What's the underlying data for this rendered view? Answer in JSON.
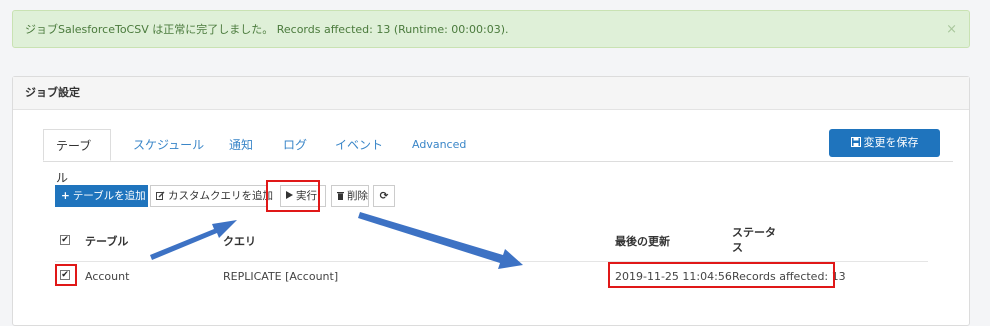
{
  "alert": {
    "message": "ジョブSalesforceToCSV は正常に完了しました。 Records affected: 13 (Runtime: 00:00:03).",
    "close": "×"
  },
  "panel": {
    "title": "ジョブ設定"
  },
  "tabs": [
    {
      "label": "テーブル"
    },
    {
      "label": "スケジュール"
    },
    {
      "label": "通知"
    },
    {
      "label": "ログ"
    },
    {
      "label": "イベント"
    },
    {
      "label": "Advanced"
    }
  ],
  "save_button": {
    "label": "変更を保存"
  },
  "toolbar": {
    "add_table": "テーブルを追加",
    "add_custom_query": "カスタムクエリを追加",
    "run": "実行",
    "delete": "削除"
  },
  "table": {
    "headers": {
      "table": "テーブル",
      "query": "クエリ",
      "last_updated": "最後の更新",
      "status_line1": "ステータ",
      "status_line2": "ス"
    },
    "rows": [
      {
        "checked": true,
        "table": "Account",
        "query": "REPLICATE [Account]",
        "last_updated": "2019-11-25 11:04:56",
        "status": "Records affected: 13"
      }
    ]
  },
  "icons": {
    "save": "floppy-icon",
    "plus": "plus-icon",
    "edit": "edit-icon",
    "play": "play-icon",
    "trash": "trash-icon",
    "refresh": "refresh-icon",
    "check": "check-icon"
  },
  "colors": {
    "primary": "#1f74bd",
    "highlight": "#e01818",
    "arrow": "#3d72c4",
    "alert_bg": "#dff0d8"
  }
}
